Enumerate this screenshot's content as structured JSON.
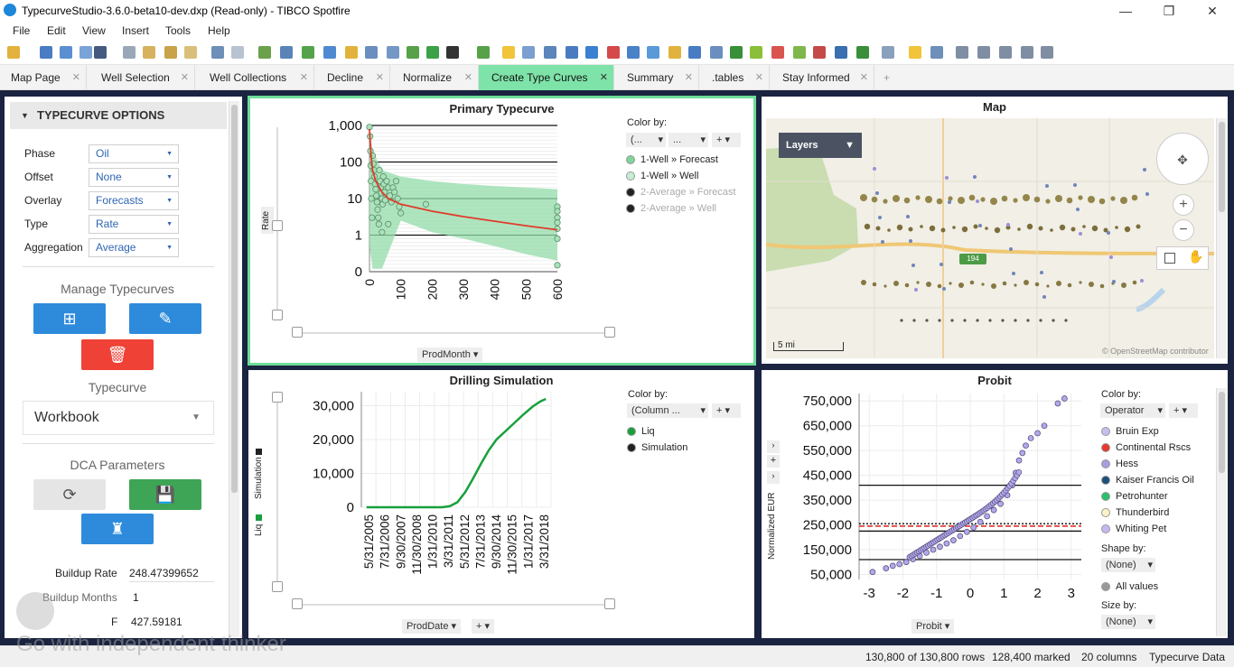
{
  "window": {
    "title": "TypecurveStudio-3.6.0-beta10-dev.dxp (Read-only) - TIBCO Spotfire"
  },
  "menu": [
    "File",
    "Edit",
    "View",
    "Insert",
    "Tools",
    "Help"
  ],
  "tabs": [
    {
      "label": "Map Page",
      "active": false
    },
    {
      "label": "Well Selection",
      "active": false
    },
    {
      "label": "Well Collections",
      "active": false
    },
    {
      "label": "Decline",
      "active": false
    },
    {
      "label": "Normalize",
      "active": false
    },
    {
      "label": "Create Type Curves",
      "active": true
    },
    {
      "label": "Summary",
      "active": false
    },
    {
      "label": ".tables",
      "active": false
    },
    {
      "label": "Stay Informed",
      "active": false
    }
  ],
  "sidepanel": {
    "header": "TYPECURVE OPTIONS",
    "fields": [
      {
        "label": "Phase",
        "value": "Oil"
      },
      {
        "label": "Offset",
        "value": "None"
      },
      {
        "label": "Overlay",
        "value": "Forecasts"
      },
      {
        "label": "Type",
        "value": "Rate"
      },
      {
        "label": "Aggregation",
        "value": "Average"
      }
    ],
    "manage_title": "Manage Typecurves",
    "typecurve_title": "Typecurve",
    "typecurve_value": "Workbook",
    "dca_title": "DCA Parameters",
    "buildup_rate_label": "Buildup Rate",
    "buildup_rate_value": "248.47399652",
    "buildup_months_label": "Buildup Months",
    "buildup_months_value": "1",
    "third_label": "F",
    "third_value": "427.59181"
  },
  "primary": {
    "title": "Primary Typecurve",
    "ylabel": "Rate",
    "xaxis_selector": "ProdMonth",
    "colorby_label": "Color by:",
    "colorby_sel1": "(...",
    "colorby_sel2": "...",
    "legend": [
      {
        "label": "1-Well » Forecast",
        "color": "#7fd49a",
        "dim": false
      },
      {
        "label": "1-Well » Well",
        "color": "#c8ecd1",
        "dim": false
      },
      {
        "label": "2-Average » Forecast",
        "color": "#222222",
        "dim": true
      },
      {
        "label": "2-Average » Well",
        "color": "#222222",
        "dim": true
      }
    ]
  },
  "map": {
    "title": "Map",
    "layers_label": "Layers",
    "highway_label": "194",
    "scale_label": "5 mi",
    "attribution": "© OpenStreetMap contributor"
  },
  "drilling": {
    "title": "Drilling Simulation",
    "yaxis_left_label1": "Simulation",
    "yaxis_left_label2": "Liq",
    "xaxis_selector": "ProdDate",
    "colorby_label": "Color by:",
    "colorby_sel1": "(Column ...",
    "legend": [
      {
        "label": "Liq",
        "color": "#18a03b"
      },
      {
        "label": "Simulation",
        "color": "#222222"
      }
    ]
  },
  "probit": {
    "title": "Probit",
    "ylabel": "Normalized EUR",
    "xaxis_selector": "Probit",
    "colorby_label": "Color by:",
    "colorby_sel1": "Operator",
    "legend": [
      {
        "label": "Bruin Exp",
        "color": "#c9bdf0"
      },
      {
        "label": "Continental Rscs",
        "color": "#e8382f"
      },
      {
        "label": "Hess",
        "color": "#a59ee0"
      },
      {
        "label": "Kaiser Francis Oil",
        "color": "#1d4f7a"
      },
      {
        "label": "Petrohunter",
        "color": "#2bbf6a"
      },
      {
        "label": "Thunderbird",
        "color": "#fbf1c4"
      },
      {
        "label": "Whiting Pet",
        "color": "#c7b7f2"
      }
    ],
    "shapeby_label": "Shape by:",
    "shapeby_value": "(None)",
    "allvalues_label": "All values",
    "sizeby_label": "Size by:",
    "sizeby_value": "(None)"
  },
  "status": {
    "rows": "130,800 of 130,800 rows",
    "marked": "128,400 marked",
    "columns": "20 columns",
    "table": "Typecurve Data"
  },
  "watermark": "Go with independent thinker",
  "chart_data": [
    {
      "type": "line",
      "title": "Primary Typecurve",
      "ylabel": "Rate",
      "xlabel": "ProdMonth",
      "y_scale": "log",
      "yticks": [
        "1,000",
        "100",
        "10",
        "1",
        "0"
      ],
      "xticks": [
        "0",
        "100",
        "200",
        "300",
        "400",
        "500",
        "600"
      ],
      "series": [
        {
          "name": "1-Well » Forecast",
          "x": [
            0,
            5,
            10,
            20,
            40,
            60,
            100,
            200,
            300,
            400,
            500,
            600
          ],
          "y": [
            800,
            150,
            60,
            30,
            15,
            10,
            7,
            4.5,
            3.2,
            2.4,
            1.8,
            1.4
          ]
        }
      ]
    },
    {
      "type": "line",
      "title": "Drilling Simulation",
      "xlabel": "ProdDate",
      "yticks": [
        "30,000",
        "20,000",
        "10,000",
        "0"
      ],
      "xticks": [
        "5/31/2005",
        "7/31/2006",
        "9/30/2007",
        "11/30/2008",
        "1/31/2010",
        "3/31/2011",
        "5/31/2012",
        "7/31/2013",
        "9/30/2014",
        "11/30/2015",
        "1/31/2017",
        "3/31/2018"
      ],
      "ylim": [
        0,
        32000
      ],
      "series": [
        {
          "name": "Liq",
          "x": [
            2005.4,
            2006.6,
            2007.7,
            2008.9,
            2010.1,
            2011.2,
            2011.8,
            2012.4,
            2013.0,
            2013.6,
            2014.2,
            2014.8,
            2015.4,
            2016.1,
            2016.8,
            2017.5,
            2018.2,
            2018.8,
            2019.2
          ],
          "y": [
            0,
            0,
            0,
            0,
            0,
            0,
            300,
            1500,
            4500,
            8500,
            12800,
            16800,
            20000,
            22500,
            25000,
            27500,
            29800,
            31300,
            32000
          ]
        }
      ]
    },
    {
      "type": "scatter",
      "title": "Probit",
      "ylabel": "Normalized EUR",
      "xlabel": "Probit",
      "yticks": [
        "750,000",
        "650,000",
        "550,000",
        "450,000",
        "350,000",
        "250,000",
        "150,000",
        "50,000"
      ],
      "xticks": [
        "-3",
        "-2",
        "-1",
        "0",
        "1",
        "2",
        "3"
      ],
      "ylim": [
        30000,
        780000
      ],
      "xlim": [
        -3.3,
        3.3
      ],
      "reference_lines": [
        {
          "y": 410000,
          "style": "solid"
        },
        {
          "y": 255000,
          "style": "dotted"
        },
        {
          "y": 245000,
          "style": "dashed-red"
        },
        {
          "y": 225000,
          "style": "solid"
        },
        {
          "y": 110000,
          "style": "solid"
        }
      ],
      "series": [
        {
          "name": "Operator",
          "x": [
            -2.9,
            -2.5,
            -2.3,
            -2.1,
            -1.9,
            -1.7,
            -1.5,
            -1.3,
            -1.1,
            -0.9,
            -0.7,
            -0.5,
            -0.3,
            -0.1,
            0.1,
            0.3,
            0.5,
            0.7,
            0.9,
            1.1,
            1.25,
            1.35,
            1.45,
            1.55,
            1.65,
            1.8,
            2.0,
            2.2,
            2.6,
            2.8
          ],
          "y": [
            60000,
            75000,
            85000,
            92000,
            100000,
            112000,
            125000,
            138000,
            150000,
            162000,
            175000,
            188000,
            205000,
            222000,
            240000,
            262000,
            285000,
            310000,
            335000,
            370000,
            410000,
            460000,
            510000,
            540000,
            570000,
            600000,
            620000,
            650000,
            740000,
            760000
          ]
        }
      ]
    }
  ]
}
